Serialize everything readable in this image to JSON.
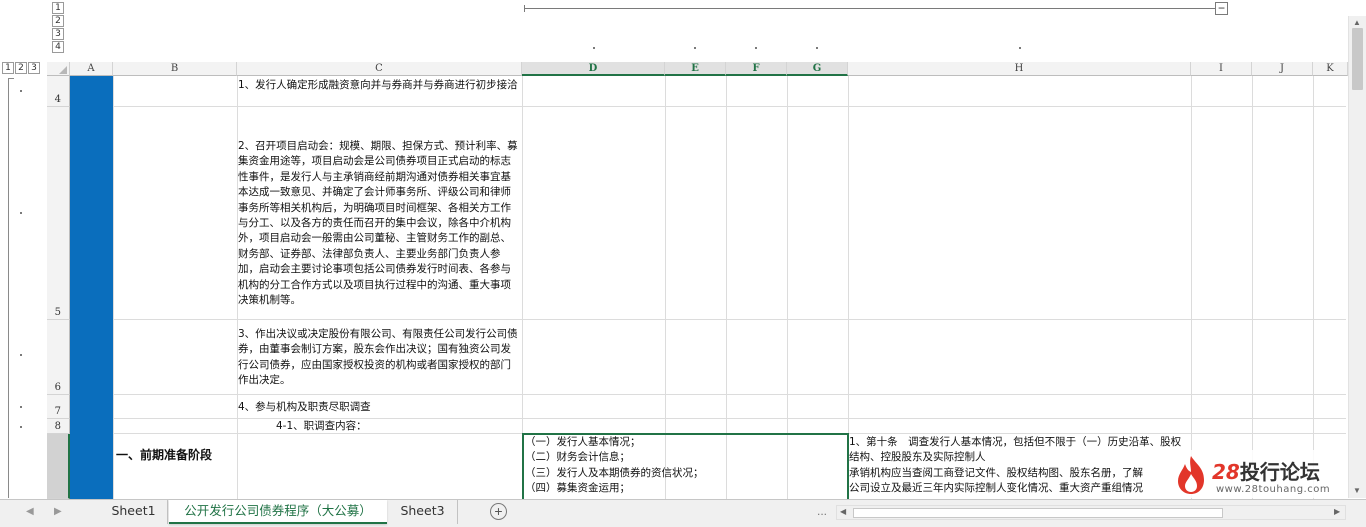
{
  "outline": {
    "row_levels": [
      "1",
      "2",
      "3",
      "4"
    ],
    "corner_levels": [
      "1",
      "2",
      "3"
    ],
    "collapse_symbol": "−"
  },
  "columns": [
    "A",
    "B",
    "C",
    "D",
    "E",
    "F",
    "G",
    "H",
    "I",
    "J",
    "K"
  ],
  "rows": [
    "4",
    "5",
    "6",
    "7",
    "8",
    ""
  ],
  "cells": {
    "C4": "1、发行人确定形成融资意向并与券商并与券商进行初步接洽",
    "C5": "2、召开项目启动会：规模、期限、担保方式、预计利率、募集资金用途等，项目启动会是公司债券项目正式启动的标志性事件，是发行人与主承销商经前期沟通对债券相关事宜基本达成一致意见、并确定了会计师事务所、评级公司和律师事务所等相关机构后，为明确项目时间框架、各相关方工作与分工、以及各方的责任而召开的集中会议，除各中介机构外，项目启动会一般需由公司董秘、主管财务工作的副总、财务部、证券部、法律部负责人、主要业务部门负责人参加，启动会主要讨论事项包括公司债券发行时间表、各参与机构的分工合作方式以及项目执行过程中的沟通、重大事项决策机制等。",
    "C6": "3、作出决议或决定股份有限公司、有限责任公司发行公司债券，由董事会制订方案，股东会作出决议；国有独资公司发行公司债券，应由国家授权投资的机构或者国家授权的部门作出决定。",
    "C7": "4、参与机构及职责尽职调查",
    "C8": "4-1、职调查内容：",
    "B9": "一、前期准备阶段",
    "D9": "（一）发行人基本情况；\n（二）财务会计信息；\n（三）发行人及本期债券的资信状况；\n（四）募集资金运用；",
    "H9": "1、第十条　调查发行人基本情况，包括但不限于（一）历史沿革、股权结构、控股股东及实际控制人\n承销机构应当查阅工商登记文件、股权结构图、股东名册，了解\n公司设立及最近三年内实际控制人变化情况、重大资产重组情况"
  },
  "sheets": {
    "tabs": [
      "Sheet1",
      "公开发行公司债券程序（大公募）",
      "Sheet3"
    ],
    "active_index": 1,
    "ellipsis": "..."
  },
  "watermark": {
    "number": "28",
    "title": "投行论坛",
    "url": "www.28touhang.com"
  },
  "colors": {
    "accent": "#217346",
    "column_a_fill": "#0a6ebd",
    "watermark_red": "#e2362a"
  }
}
